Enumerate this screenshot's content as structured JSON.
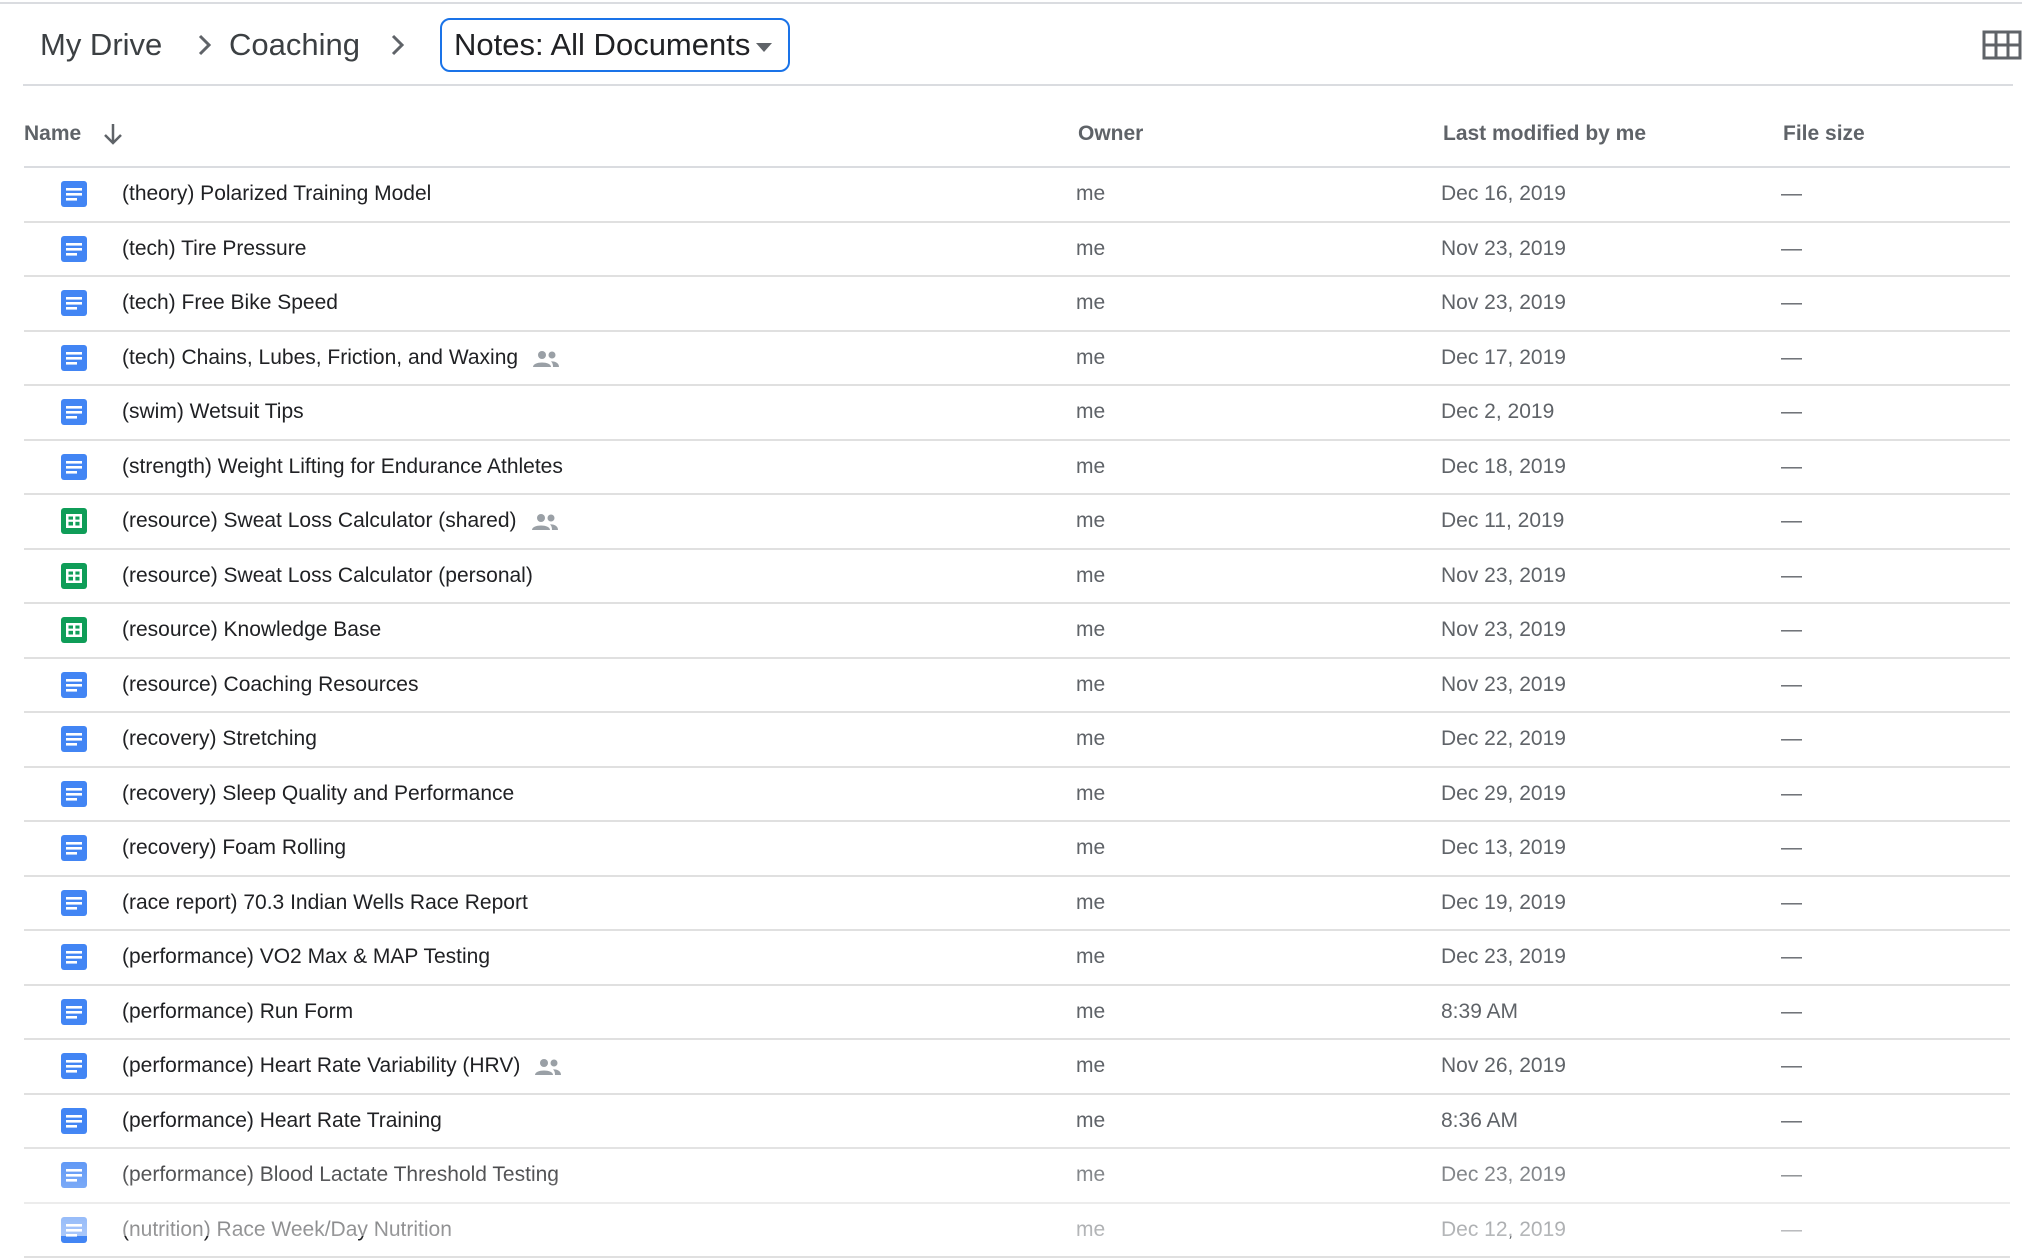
{
  "breadcrumb": {
    "items": [
      "My Drive",
      "Coaching"
    ],
    "current": "Notes: All Documents"
  },
  "view_toggle_icon": "grid-view-icon",
  "columns": {
    "name": "Name",
    "owner": "Owner",
    "modified": "Last modified by me",
    "size": "File size"
  },
  "sort": {
    "column": "name",
    "direction": "descending",
    "icon": "arrow-down-icon"
  },
  "colors": {
    "docs_blue": "#4285f4",
    "sheets_green": "#0f9d58",
    "accent": "#1a73e8"
  },
  "files": [
    {
      "name": "(theory) Polarized Training Model",
      "type": "doc",
      "shared": false,
      "owner": "me",
      "modified": "Dec 16, 2019",
      "size": "—"
    },
    {
      "name": "(tech) Tire Pressure",
      "type": "doc",
      "shared": false,
      "owner": "me",
      "modified": "Nov 23, 2019",
      "size": "—"
    },
    {
      "name": "(tech) Free Bike Speed",
      "type": "doc",
      "shared": false,
      "owner": "me",
      "modified": "Nov 23, 2019",
      "size": "—"
    },
    {
      "name": "(tech) Chains, Lubes, Friction, and Waxing",
      "type": "doc",
      "shared": true,
      "owner": "me",
      "modified": "Dec 17, 2019",
      "size": "—"
    },
    {
      "name": "(swim) Wetsuit Tips",
      "type": "doc",
      "shared": false,
      "owner": "me",
      "modified": "Dec 2, 2019",
      "size": "—"
    },
    {
      "name": "(strength) Weight Lifting for Endurance Athletes",
      "type": "doc",
      "shared": false,
      "owner": "me",
      "modified": "Dec 18, 2019",
      "size": "—"
    },
    {
      "name": "(resource) Sweat Loss Calculator (shared)",
      "type": "sheet",
      "shared": true,
      "owner": "me",
      "modified": "Dec 11, 2019",
      "size": "—"
    },
    {
      "name": "(resource) Sweat Loss Calculator (personal)",
      "type": "sheet",
      "shared": false,
      "owner": "me",
      "modified": "Nov 23, 2019",
      "size": "—"
    },
    {
      "name": "(resource) Knowledge Base",
      "type": "sheet",
      "shared": false,
      "owner": "me",
      "modified": "Nov 23, 2019",
      "size": "—"
    },
    {
      "name": "(resource) Coaching Resources",
      "type": "doc",
      "shared": false,
      "owner": "me",
      "modified": "Nov 23, 2019",
      "size": "—"
    },
    {
      "name": "(recovery) Stretching",
      "type": "doc",
      "shared": false,
      "owner": "me",
      "modified": "Dec 22, 2019",
      "size": "—"
    },
    {
      "name": "(recovery) Sleep Quality and Performance",
      "type": "doc",
      "shared": false,
      "owner": "me",
      "modified": "Dec 29, 2019",
      "size": "—"
    },
    {
      "name": "(recovery) Foam Rolling",
      "type": "doc",
      "shared": false,
      "owner": "me",
      "modified": "Dec 13, 2019",
      "size": "—"
    },
    {
      "name": "(race report) 70.3 Indian Wells Race Report",
      "type": "doc",
      "shared": false,
      "owner": "me",
      "modified": "Dec 19, 2019",
      "size": "—"
    },
    {
      "name": "(performance) VO2 Max & MAP Testing",
      "type": "doc",
      "shared": false,
      "owner": "me",
      "modified": "Dec 23, 2019",
      "size": "—"
    },
    {
      "name": "(performance) Run Form",
      "type": "doc",
      "shared": false,
      "owner": "me",
      "modified": "8:39 AM",
      "size": "—"
    },
    {
      "name": "(performance) Heart Rate Variability (HRV)",
      "type": "doc",
      "shared": true,
      "owner": "me",
      "modified": "Nov 26, 2019",
      "size": "—"
    },
    {
      "name": "(performance) Heart Rate Training",
      "type": "doc",
      "shared": false,
      "owner": "me",
      "modified": "8:36 AM",
      "size": "—"
    },
    {
      "name": "(performance) Blood Lactate Threshold Testing",
      "type": "doc",
      "shared": false,
      "owner": "me",
      "modified": "Dec 23, 2019",
      "size": "—"
    },
    {
      "name": "(nutrition) Race Week/Day Nutrition",
      "type": "doc",
      "shared": false,
      "owner": "me",
      "modified": "Dec 12, 2019",
      "size": "—"
    }
  ]
}
